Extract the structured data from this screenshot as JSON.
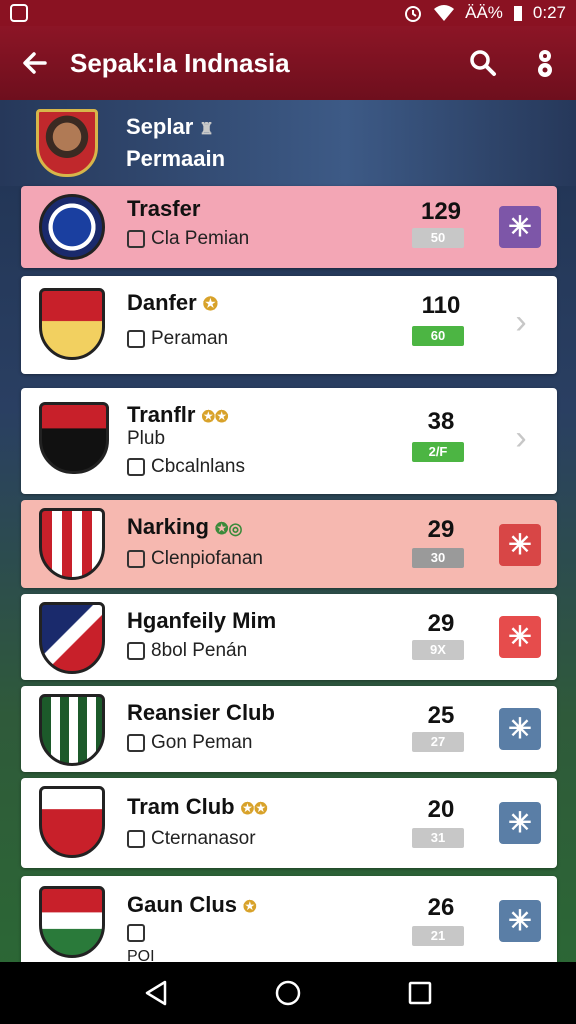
{
  "status_bar": {
    "battery_text": "ÄÄ%",
    "time": "0:27"
  },
  "app_bar": {
    "title": "Sepak:la Indnasia"
  },
  "header": {
    "line1": "Seplar",
    "line2": "Permaain"
  },
  "rows": [
    {
      "name": "Trasfer",
      "sub": "Cla Pemian",
      "points": "129",
      "badge": "50",
      "badge_color": "#c7c7c7",
      "action": "btn",
      "action_color": "#7d56a8",
      "style": "pink"
    },
    {
      "name": "Danfer",
      "sub": "Peraman",
      "points": "110",
      "badge": "60",
      "badge_color": "#4cb543",
      "action": "chevron",
      "action_color": "",
      "style": "white"
    },
    {
      "name": "Tranflr",
      "name2": "Plub",
      "sub": "Cbcalnlans",
      "points": "38",
      "badge": "2/F",
      "badge_color": "#4cb543",
      "action": "chevron",
      "action_color": "",
      "style": "white"
    },
    {
      "name": "Narking",
      "sub": "Clenpiofanan",
      "points": "29",
      "badge": "30",
      "badge_color": "#9a9a9a",
      "action": "btn",
      "action_color": "#d84646",
      "style": "salmon"
    },
    {
      "name": "Hganfeily Mim",
      "sub": "8bol Penán",
      "points": "29",
      "badge": "9X",
      "badge_color": "#c7c7c7",
      "action": "btn",
      "action_color": "#e64c4c",
      "style": "white"
    },
    {
      "name": "Reansier Club",
      "sub": "Gon Peman",
      "points": "25",
      "badge": "27",
      "badge_color": "#c7c7c7",
      "action": "btn",
      "action_color": "#5a7ea6",
      "style": "white"
    },
    {
      "name": "Tram Club",
      "sub": "Cternanasor",
      "points": "20",
      "badge": "31",
      "badge_color": "#c7c7c7",
      "action": "btn",
      "action_color": "#5a7ea6",
      "style": "white"
    },
    {
      "name": "Gaun Clus",
      "sub": "",
      "sub2": "POI",
      "points": "26",
      "badge": "21",
      "badge_color": "#c7c7c7",
      "action": "btn",
      "action_color": "#5a7ea6",
      "style": "white"
    }
  ],
  "action_glyphs": {
    "star": "✳",
    "chevron": "›"
  },
  "colors": {
    "app_bar": "#8c1526",
    "status_bar": "#8a1222"
  }
}
